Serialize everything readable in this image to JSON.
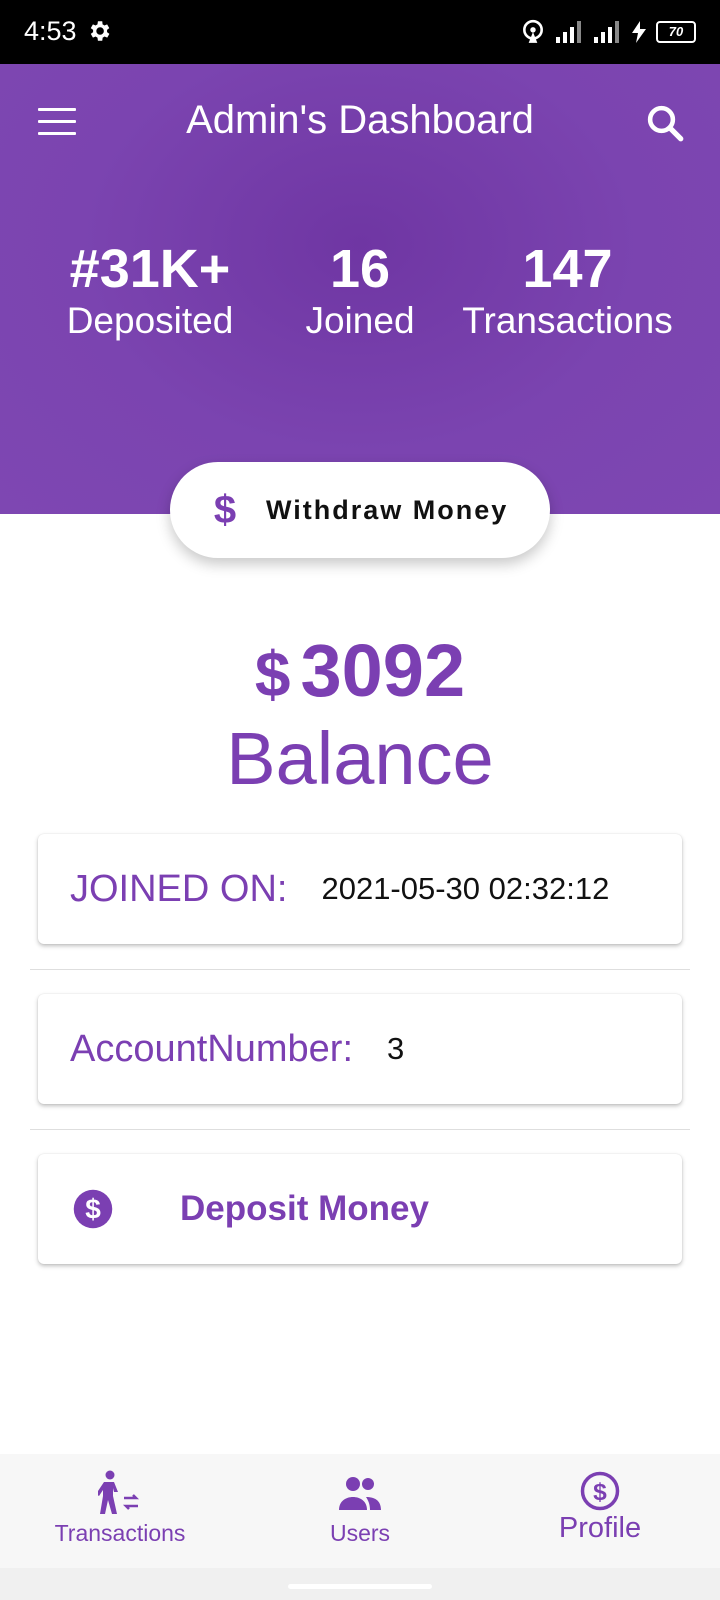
{
  "status_bar": {
    "time": "4:53",
    "battery": "70"
  },
  "header": {
    "title": "Admin's Dashboard"
  },
  "stats": [
    {
      "value": "#31K+",
      "label": "Deposited"
    },
    {
      "value": "16",
      "label": "Joined"
    },
    {
      "value": "147",
      "label": "Transactions"
    }
  ],
  "withdraw": {
    "icon_glyph": "$",
    "label": "Withdraw Money"
  },
  "balance": {
    "currency": "$",
    "amount": "3092",
    "label": "Balance"
  },
  "cards": {
    "joined": {
      "label": "JOINED ON:",
      "value": "2021-05-30 02:32:12"
    },
    "account": {
      "label": "AccountNumber:",
      "value": "3"
    },
    "deposit": {
      "label": "Deposit Money"
    }
  },
  "bottom_nav": [
    {
      "label": "Transactions",
      "icon": "transactions-icon"
    },
    {
      "label": "Users",
      "icon": "users-icon"
    },
    {
      "label": "Profile",
      "icon": "profile-dollar-icon"
    }
  ],
  "colors": {
    "primary": "#7b3fb2",
    "header_bg": "#7b44b0",
    "white": "#ffffff"
  }
}
